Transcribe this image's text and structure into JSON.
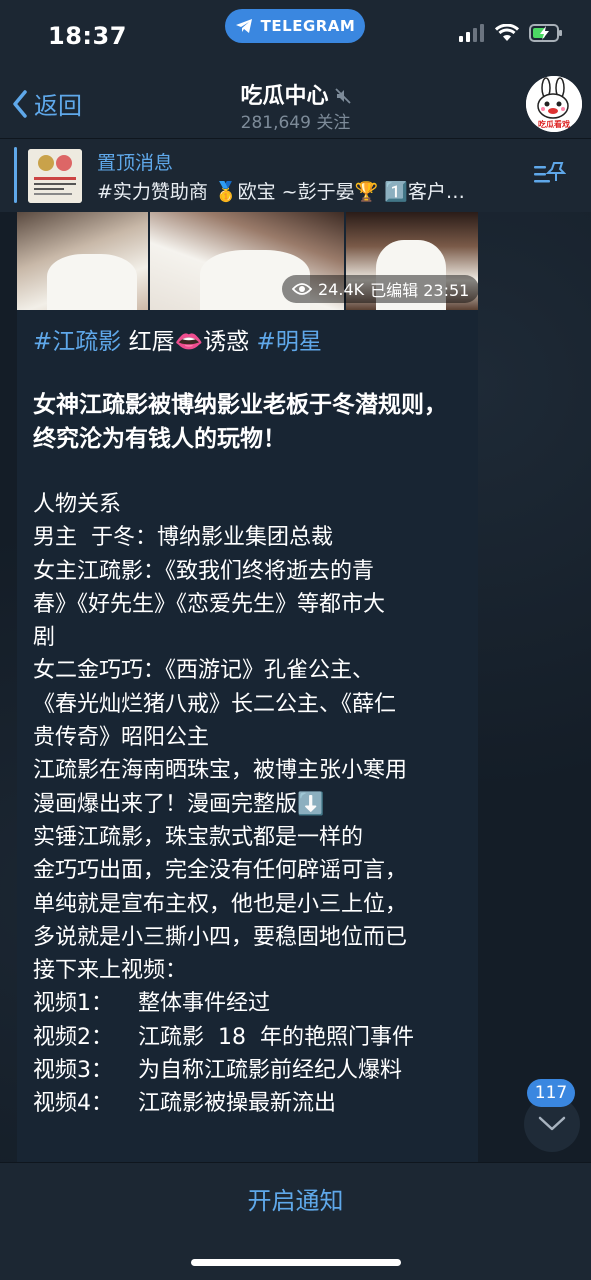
{
  "status_bar": {
    "time": "18:37",
    "app_pill": "TELEGRAM"
  },
  "header": {
    "back_label": "返回",
    "channel_title": "吃瓜中心",
    "subscribers": "281,649 关注",
    "avatar_caption": "吃瓜看戏"
  },
  "pinned": {
    "title": "置顶消息",
    "text": "#实力赞助商 🥇欧宝 ~彭于晏🏆 1️⃣客户…"
  },
  "message": {
    "views": "24.4K",
    "edited_time": "已编辑 23:51",
    "tags": {
      "tag1": "#江疏影",
      "middle": " 红唇👄诱惑 ",
      "tag2": "#明星"
    },
    "headline": "女神江疏影被博纳影业老板于冬潜规则，终究沦为有钱人的玩物！",
    "lines": [
      "人物关系",
      "男主  于冬：博纳影业集团总裁",
      "女主江疏影：《致我们终将逝去的青",
      "春》《好先生》《恋爱先生》等都市大",
      "剧",
      "女二金巧巧：《西游记》孔雀公主、",
      "《春光灿烂猪八戒》长二公主、《薛仁",
      "贵传奇》昭阳公主",
      "江疏影在海南晒珠宝，被博主张小寒用",
      "漫画爆出来了！漫画完整版⬇️",
      "实锤江疏影，珠宝款式都是一样的",
      "金巧巧出面，完全没有任何辟谣可言，",
      "单纯就是宣布主权，他也是小三上位，",
      "多说就是小三撕小四，要稳固地位而已",
      "接下来上视频："
    ],
    "videos": [
      {
        "label": "视频1：",
        "desc": "整体事件经过"
      },
      {
        "label": "视频2：",
        "desc": "江疏影  18  年的艳照门事件"
      },
      {
        "label": "视频3：",
        "desc": "为自称江疏影前经纪人爆料"
      },
      {
        "label": "视频4：",
        "desc": "江疏影被操最新流出"
      }
    ]
  },
  "scroll": {
    "unread_count": "117"
  },
  "bottom": {
    "notify_label": "开启通知"
  },
  "colors": {
    "accent": "#5fa8ea",
    "bg": "#0e1621",
    "bubble": "#182533",
    "bar": "#1c2733"
  }
}
